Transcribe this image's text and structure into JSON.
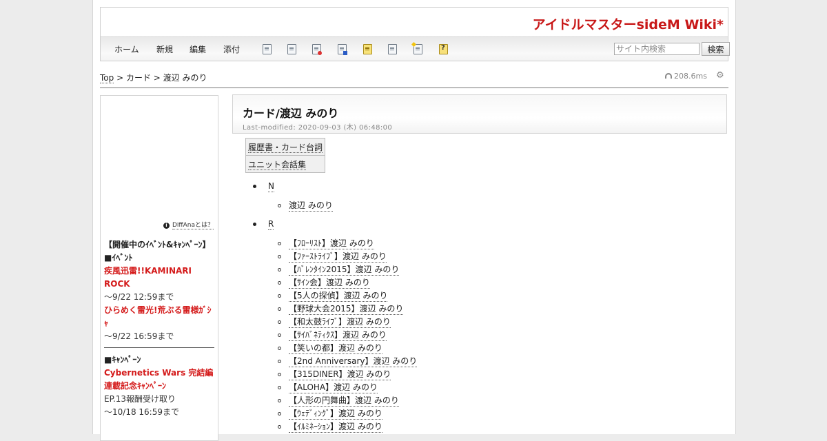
{
  "site": {
    "title": "アイドルマスターsideM Wiki*"
  },
  "toolbar": {
    "nav": [
      "ホーム",
      "新規",
      "編集",
      "添付"
    ],
    "icons": [
      "page-copy-icon",
      "page-search-icon",
      "page-diff-icon",
      "page-save-icon",
      "page-lock-icon",
      "page-duplicate-icon",
      "page-new-icon",
      "help-icon"
    ],
    "search_placeholder": "サイト内検索",
    "search_button": "検索"
  },
  "breadcrumb": {
    "top": "Top",
    "sep1": " > ",
    "category": "カード",
    "sep2": " > ",
    "current": "渡辺 みのり"
  },
  "timing": "208.6ms",
  "sidebar": {
    "diffana": "DiffAnaとは？",
    "heading": "【開催中のｲﾍﾞﾝﾄ&ｷｬﾝﾍﾟｰﾝ】",
    "event_label": "■ｲﾍﾞﾝﾄ",
    "event1": "疾風迅雷!!KAMINARI ROCK",
    "event1_until": "～9/22 12:59まで",
    "event2": "ひらめく雷光!荒ぶる雷様ｶﾞｼｬ",
    "event2_until": "～9/22 16:59まで",
    "campaign_label": "■ｷｬﾝﾍﾟｰﾝ",
    "campaign1": "Cybernetics Wars 完結編連載記念ｷｬﾝﾍﾟｰﾝ",
    "campaign1_detail": "EP.13報酬受け取り",
    "campaign1_until": "～10/18 16:59まで"
  },
  "page": {
    "title": "カード/渡辺 みのり",
    "last_modified": "Last-modified: 2020-09-03 (木) 06:48:00",
    "links_table": [
      "履歴書・カード台詞",
      "ユニット会話集"
    ],
    "sections": [
      {
        "label": "N",
        "items": [
          "渡辺 みのり"
        ]
      },
      {
        "label": "R",
        "items": [
          "【ﾌﾛｰﾘｽﾄ】渡辺 みのり",
          "【ﾌｧｰｽﾄﾗｲﾌﾞ】渡辺 みのり",
          "【ﾊﾞﾚﾝﾀｲﾝ2015】渡辺 みのり",
          "【ｻｲﾝ会】渡辺 みのり",
          "【5人の探偵】渡辺 みのり",
          "【野球大会2015】渡辺 みのり",
          "【和太鼓ﾗｲﾌﾞ】渡辺 みのり",
          "【ｻｲﾊﾞﾈﾃｨｸｽ】渡辺 みのり",
          "【笑いの都】渡辺 みのり",
          "【2nd Anniversary】渡辺 みのり",
          "【315DINER】渡辺 みのり",
          "【ALOHA】渡辺 みのり",
          "【人形の円舞曲】渡辺 みのり",
          "【ｳｪﾃﾞｨﾝｸﾞ】渡辺 みのり",
          "【ｲﾙﾐﾈｰｼｮﾝ】渡辺 みのり"
        ]
      }
    ]
  }
}
